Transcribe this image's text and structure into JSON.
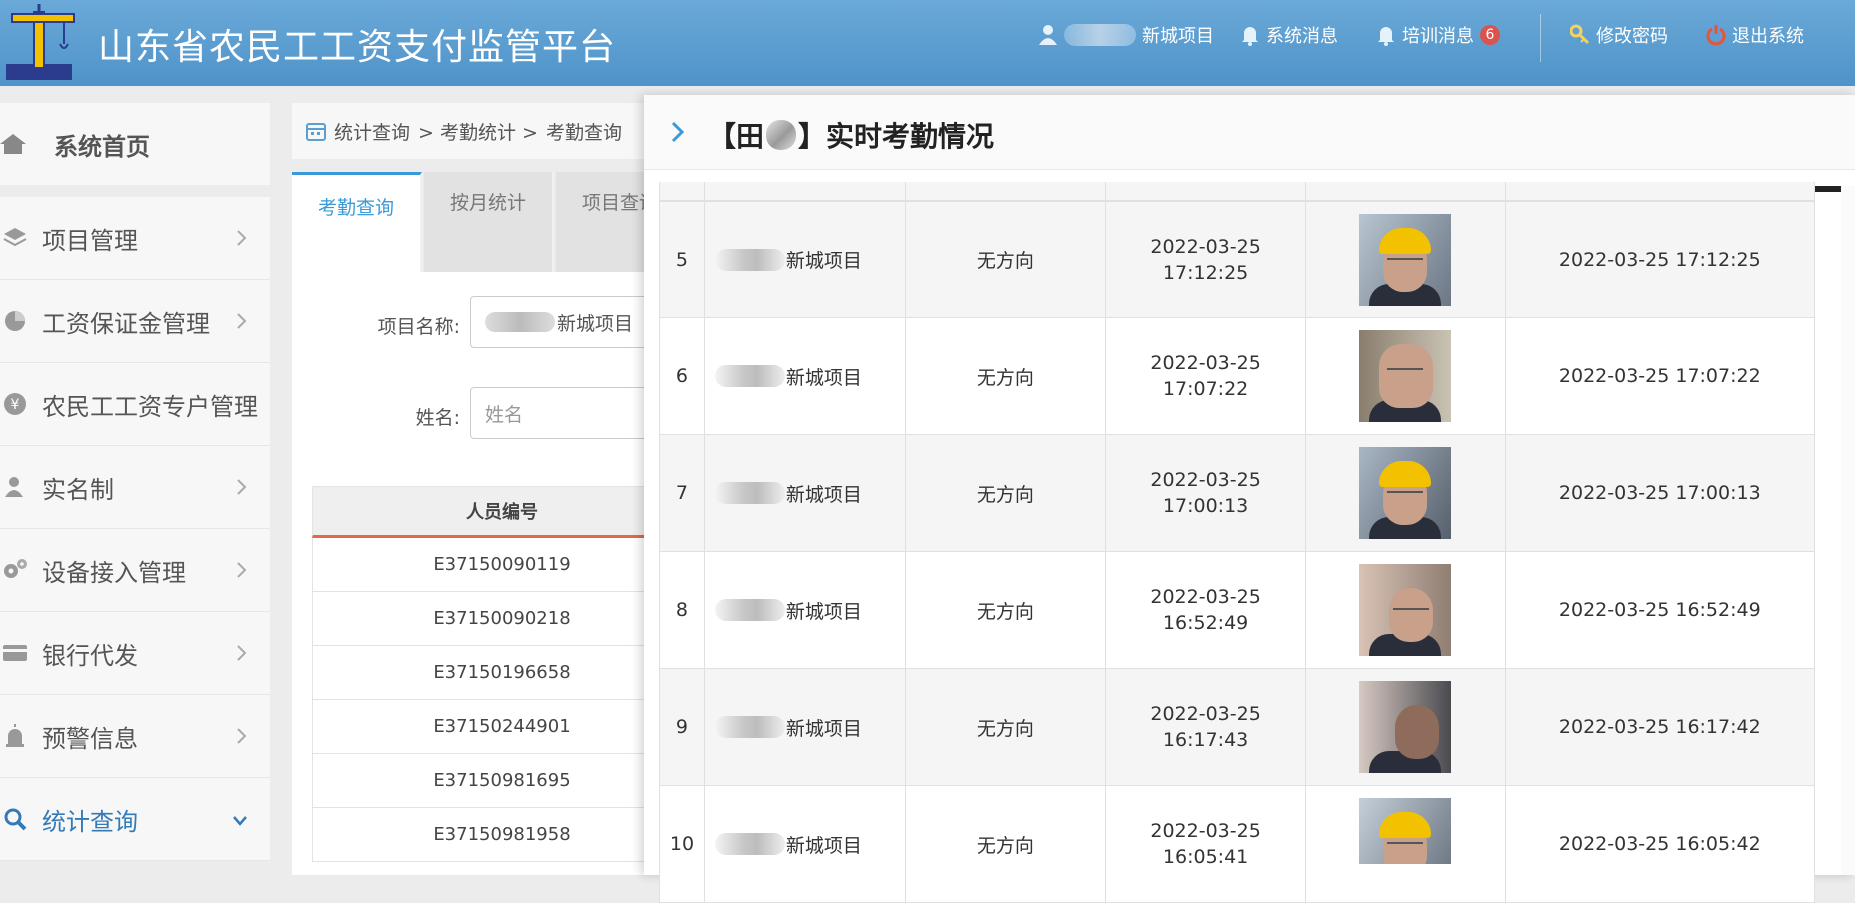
{
  "header": {
    "title": "山东省农民工工资支付监管平台",
    "user_project": "新城项目",
    "system_msg": "系统消息",
    "training_msg": "培训消息",
    "training_count": "6",
    "change_password": "修改密码",
    "logout": "退出系统",
    "colors": {
      "bar": "#5b9ed1",
      "badge": "#d9534f"
    }
  },
  "sidebar": {
    "home": "系统首页",
    "items": [
      {
        "label": "项目管理",
        "icon": "layers-icon"
      },
      {
        "label": "工资保证金管理",
        "icon": "pie-icon"
      },
      {
        "label": "农民工工资专户管理",
        "icon": "yen-icon"
      },
      {
        "label": "实名制",
        "icon": "user-icon"
      },
      {
        "label": "设备接入管理",
        "icon": "gears-icon"
      },
      {
        "label": "银行代发",
        "icon": "card-icon"
      },
      {
        "label": "预警信息",
        "icon": "alarm-icon"
      },
      {
        "label": "统计查询",
        "icon": "search-icon",
        "active": true
      }
    ]
  },
  "breadcrumb": {
    "part1": "统计查询",
    "part2": "> 考勤统计 >",
    "part3": "考勤查询"
  },
  "tabs": [
    "考勤查询",
    "按月统计",
    "项目查询"
  ],
  "form": {
    "project_label": "项目名称:",
    "project_value": "新城项目",
    "name_label": "姓名:",
    "name_placeholder": "姓名"
  },
  "bg_table": {
    "header": "人员编号",
    "rows": [
      "E37150090119",
      "E37150090218",
      "E37150196658",
      "E37150244901",
      "E37150981695",
      "E37150981958"
    ]
  },
  "modal": {
    "title_left": "【田",
    "title_right": "】实时考勤情况",
    "rows": [
      {
        "idx": "5",
        "project": "新城项目",
        "direction": "无方向",
        "date": "2022-03-25",
        "time": "17:12:25",
        "record": "2022-03-25 17:12:25",
        "helmet": true
      },
      {
        "idx": "6",
        "project": "新城项目",
        "direction": "无方向",
        "date": "2022-03-25",
        "time": "17:07:22",
        "record": "2022-03-25 17:07:22",
        "helmet": false
      },
      {
        "idx": "7",
        "project": "新城项目",
        "direction": "无方向",
        "date": "2022-03-25",
        "time": "17:00:13",
        "record": "2022-03-25 17:00:13",
        "helmet": true
      },
      {
        "idx": "8",
        "project": "新城项目",
        "direction": "无方向",
        "date": "2022-03-25",
        "time": "16:52:49",
        "record": "2022-03-25 16:52:49",
        "helmet": false
      },
      {
        "idx": "9",
        "project": "新城项目",
        "direction": "无方向",
        "date": "2022-03-25",
        "time": "16:17:43",
        "record": "2022-03-25 16:17:42",
        "helmet": false
      },
      {
        "idx": "10",
        "project": "新城项目",
        "direction": "无方向",
        "date": "2022-03-25",
        "time": "16:05:41",
        "record": "2022-03-25 16:05:42",
        "helmet": true
      }
    ]
  }
}
